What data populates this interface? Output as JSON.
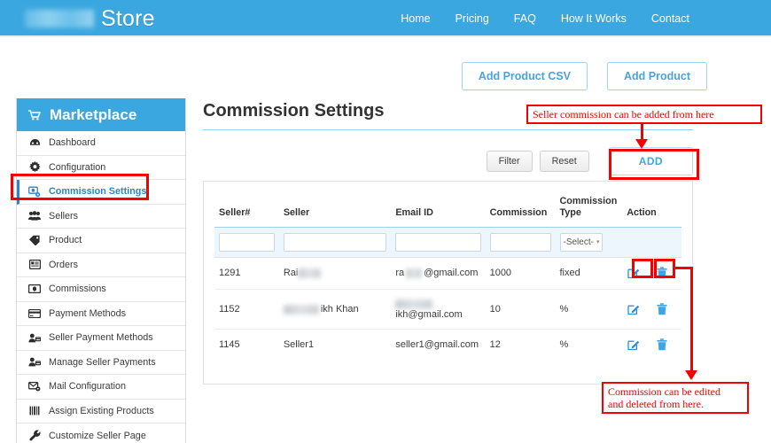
{
  "topbar": {
    "brand_text": "Store",
    "brand_logo_redacted": true,
    "nav": [
      {
        "label": "Home"
      },
      {
        "label": "Pricing"
      },
      {
        "label": "FAQ"
      },
      {
        "label": "How It Works"
      },
      {
        "label": "Contact"
      }
    ],
    "bg_color": "#3ba7e0"
  },
  "top_actions": {
    "add_product_csv_label": "Add Product CSV",
    "add_product_label": "Add Product"
  },
  "sidebar": {
    "header": {
      "title": "Marketplace",
      "icon": "shopping-cart-icon"
    },
    "items": [
      {
        "label": "Dashboard",
        "icon": "dashboard-icon",
        "active": false
      },
      {
        "label": "Configuration",
        "icon": "gear-icon",
        "active": false
      },
      {
        "label": "Commission Settings",
        "icon": "commission-settings-icon",
        "active": true
      },
      {
        "label": "Sellers",
        "icon": "users-icon",
        "active": false
      },
      {
        "label": "Product",
        "icon": "tag-icon",
        "active": false
      },
      {
        "label": "Orders",
        "icon": "list-icon",
        "active": false
      },
      {
        "label": "Commissions",
        "icon": "money-icon",
        "active": false
      },
      {
        "label": "Payment Methods",
        "icon": "credit-card-icon",
        "active": false
      },
      {
        "label": "Seller Payment Methods",
        "icon": "user-card-icon",
        "active": false
      },
      {
        "label": "Manage Seller Payments",
        "icon": "user-card-icon",
        "active": false
      },
      {
        "label": "Mail Configuration",
        "icon": "mail-gear-icon",
        "active": false
      },
      {
        "label": "Assign Existing Products",
        "icon": "barcode-icon",
        "active": false
      },
      {
        "label": "Customize Seller Page",
        "icon": "wrench-icon",
        "active": false
      }
    ]
  },
  "main": {
    "page_title": "Commission Settings",
    "toolbar": {
      "filter_label": "Filter",
      "reset_label": "Reset",
      "add_label": "ADD"
    },
    "table": {
      "columns": [
        "Seller#",
        "Seller",
        "Email ID",
        "Commission",
        "Commission Type",
        "Action"
      ],
      "filter_row": {
        "seller_number": "",
        "seller": "",
        "email": "",
        "commission": "",
        "commission_type_selected": "-Select-"
      },
      "rows": [
        {
          "seller_number": "1291",
          "seller": "Rai",
          "seller_redacted": true,
          "email_prefix": "ra",
          "email_redacted": true,
          "email_suffix": "@gmail.com",
          "commission": "1000",
          "commission_type": "fixed",
          "actions": [
            "edit-icon",
            "delete-icon"
          ]
        },
        {
          "seller_number": "1152",
          "seller": "ikh Khan",
          "seller_redacted": true,
          "email_prefix": "",
          "email_redacted": true,
          "email_suffix": "ikh@gmail.com",
          "commission": "10",
          "commission_type": "%",
          "actions": [
            "edit-icon",
            "delete-icon"
          ]
        },
        {
          "seller_number": "1145",
          "seller": "Seller1",
          "seller_redacted": false,
          "email_prefix": "seller1@gmail.com",
          "email_redacted": false,
          "email_suffix": "",
          "commission": "12",
          "commission_type": "%",
          "actions": [
            "edit-icon",
            "delete-icon"
          ]
        }
      ]
    }
  },
  "annotations": {
    "color": "#f40000",
    "top_note": "Seller commission can be added from here",
    "bottom_note": "Commission can be edited\nand deleted from here."
  }
}
